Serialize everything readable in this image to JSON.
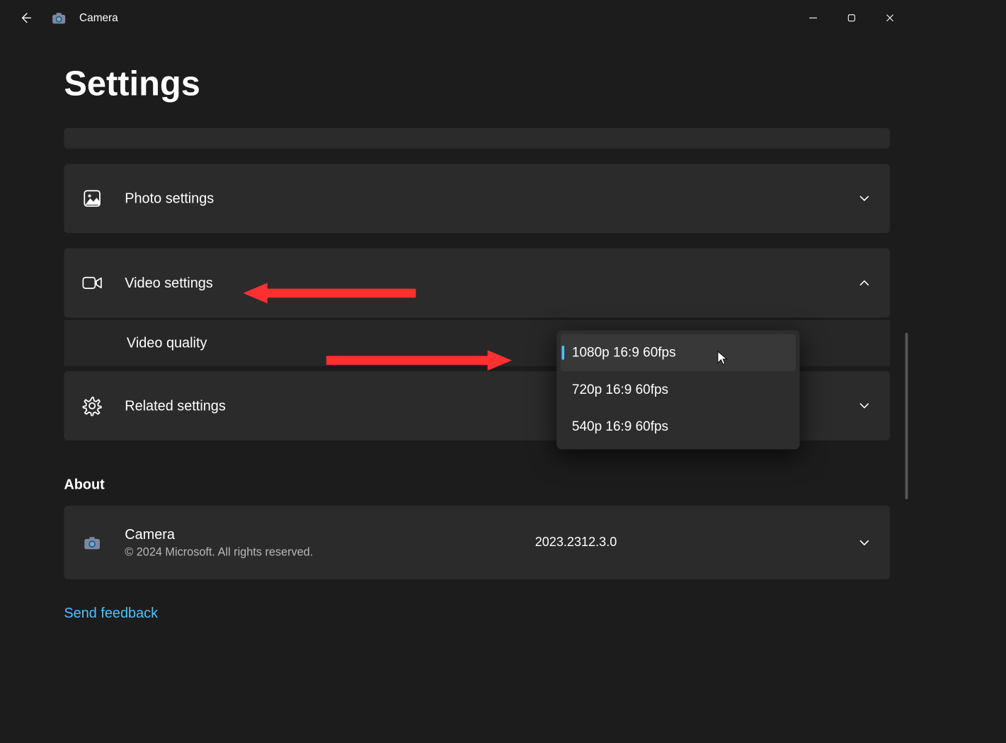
{
  "titlebar": {
    "app_name": "Camera"
  },
  "page": {
    "title": "Settings"
  },
  "sections": {
    "photo": {
      "label": "Photo settings"
    },
    "video": {
      "label": "Video settings"
    },
    "video_quality": {
      "label": "Video quality"
    },
    "related": {
      "label": "Related settings"
    }
  },
  "dropdown": {
    "options": [
      "1080p 16:9 60fps",
      "720p 16:9 60fps",
      "540p 16:9 60fps"
    ]
  },
  "about": {
    "heading": "About",
    "name": "Camera",
    "copyright": "© 2024 Microsoft. All rights reserved.",
    "version": "2023.2312.3.0"
  },
  "feedback": {
    "label": "Send feedback"
  }
}
